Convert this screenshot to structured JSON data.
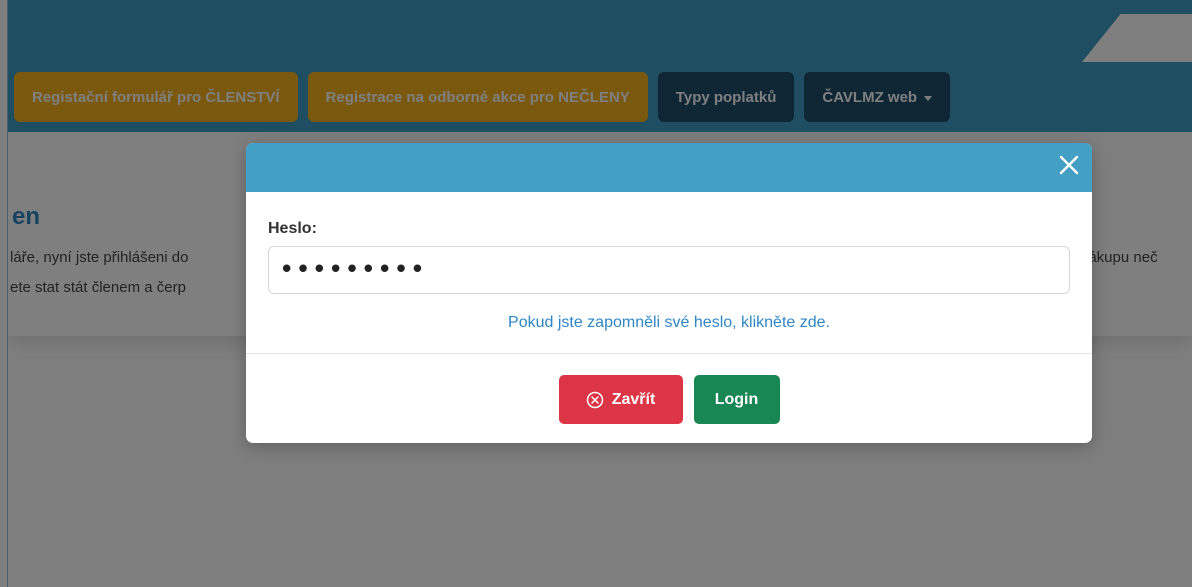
{
  "nav": {
    "items": [
      {
        "label": "Registační formulář pro ČLENSTVÍ"
      },
      {
        "label": "Registrace na odborné akce pro NEČLENY"
      },
      {
        "label": "Typy poplatků"
      },
      {
        "label": "ČAVLMZ web"
      }
    ]
  },
  "page": {
    "heading_fragment": "en",
    "text_line1": "láře, nyní jste přihlášeni do",
    "text_line2": "ete stat stát členem a čerp",
    "text_right": "nákupu neč"
  },
  "modal": {
    "password_label": "Heslo:",
    "password_value": "•••••••••",
    "forgot_link": "Pokud jste zapomněli své heslo, klikněte zde.",
    "close_label": "Zavřít",
    "login_label": "Login"
  },
  "colors": {
    "header_blue": "#449fc5",
    "nav_gold": "#f4b11c",
    "nav_dark": "#1e4e68",
    "danger": "#dc3545",
    "success": "#198754",
    "link": "#2f86c4"
  },
  "icons": {
    "close": "close-icon",
    "circle_x": "circle-x-icon",
    "dropdown": "caret-down-icon"
  }
}
